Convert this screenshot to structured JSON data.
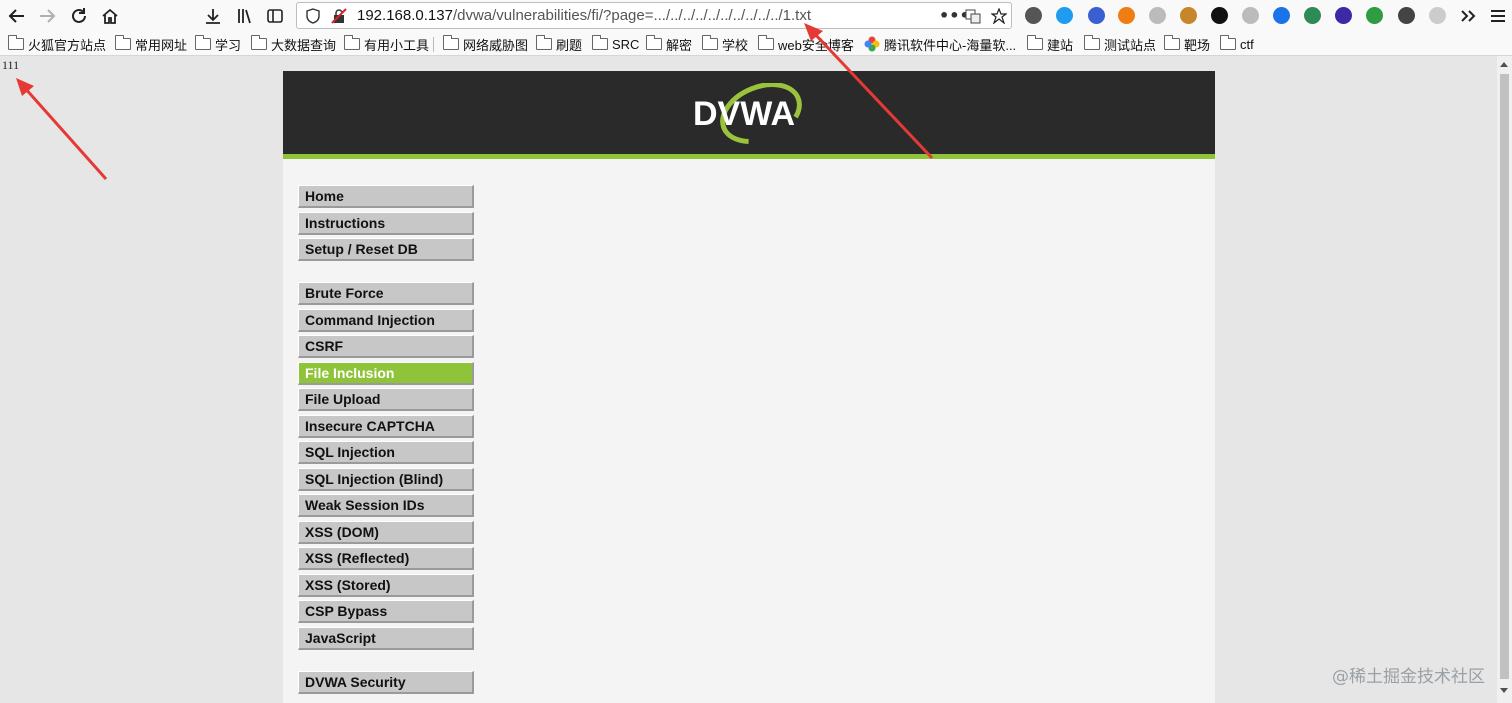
{
  "browser": {
    "url_host": "192.168.0.137",
    "url_path": "/dvwa/vulnerabilities/fi/?page=.../../../../../../../../../../1.txt",
    "extensions": [
      "ext-1-icon",
      "ext-2-icon",
      "ext-3-icon",
      "ext-4-icon",
      "ext-5-icon",
      "ext-6-icon",
      "ext-7-icon",
      "ext-8-icon",
      "ext-9-icon",
      "translate-icon",
      "t-icon",
      "diamond-icon",
      "green-i-icon",
      "ext-14-icon",
      "ext-15-icon"
    ],
    "brand_colors": {
      "accent_green": "#8fc43a",
      "header_dark": "#2a2a2a",
      "annotation_red": "#e53935"
    }
  },
  "bookmarks": [
    {
      "label": "火狐官方站点",
      "icon": "folder-icon"
    },
    {
      "label": "常用网址",
      "icon": "folder-icon"
    },
    {
      "label": "学习",
      "icon": "folder-icon"
    },
    {
      "label": "大数据查询",
      "icon": "folder-icon"
    },
    {
      "label": "有用小工具",
      "icon": "folder-icon"
    },
    {
      "label": "网络威胁图",
      "icon": "folder-icon"
    },
    {
      "label": "刷题",
      "icon": "folder-icon"
    },
    {
      "label": "SRC",
      "icon": "folder-icon"
    },
    {
      "label": "解密",
      "icon": "folder-icon"
    },
    {
      "label": "学校",
      "icon": "folder-icon"
    },
    {
      "label": "web安全博客",
      "icon": "folder-icon"
    },
    {
      "label": "腾讯软件中心-海量软...",
      "icon": "flower-icon"
    },
    {
      "label": "建站",
      "icon": "folder-icon"
    },
    {
      "label": "测试站点",
      "icon": "folder-icon"
    },
    {
      "label": "靶场",
      "icon": "folder-icon"
    },
    {
      "label": "ctf",
      "icon": "folder-icon"
    }
  ],
  "page": {
    "output_text": "111",
    "logo_text": "DVWA"
  },
  "menu": {
    "group1": [
      "Home",
      "Instructions",
      "Setup / Reset DB"
    ],
    "group2": [
      "Brute Force",
      "Command Injection",
      "CSRF",
      "File Inclusion",
      "File Upload",
      "Insecure CAPTCHA",
      "SQL Injection",
      "SQL Injection (Blind)",
      "Weak Session IDs",
      "XSS (DOM)",
      "XSS (Reflected)",
      "XSS (Stored)",
      "CSP Bypass",
      "JavaScript"
    ],
    "group3": [
      "DVWA Security"
    ],
    "selected": "File Inclusion"
  },
  "watermark": "@稀土掘金技术社区"
}
